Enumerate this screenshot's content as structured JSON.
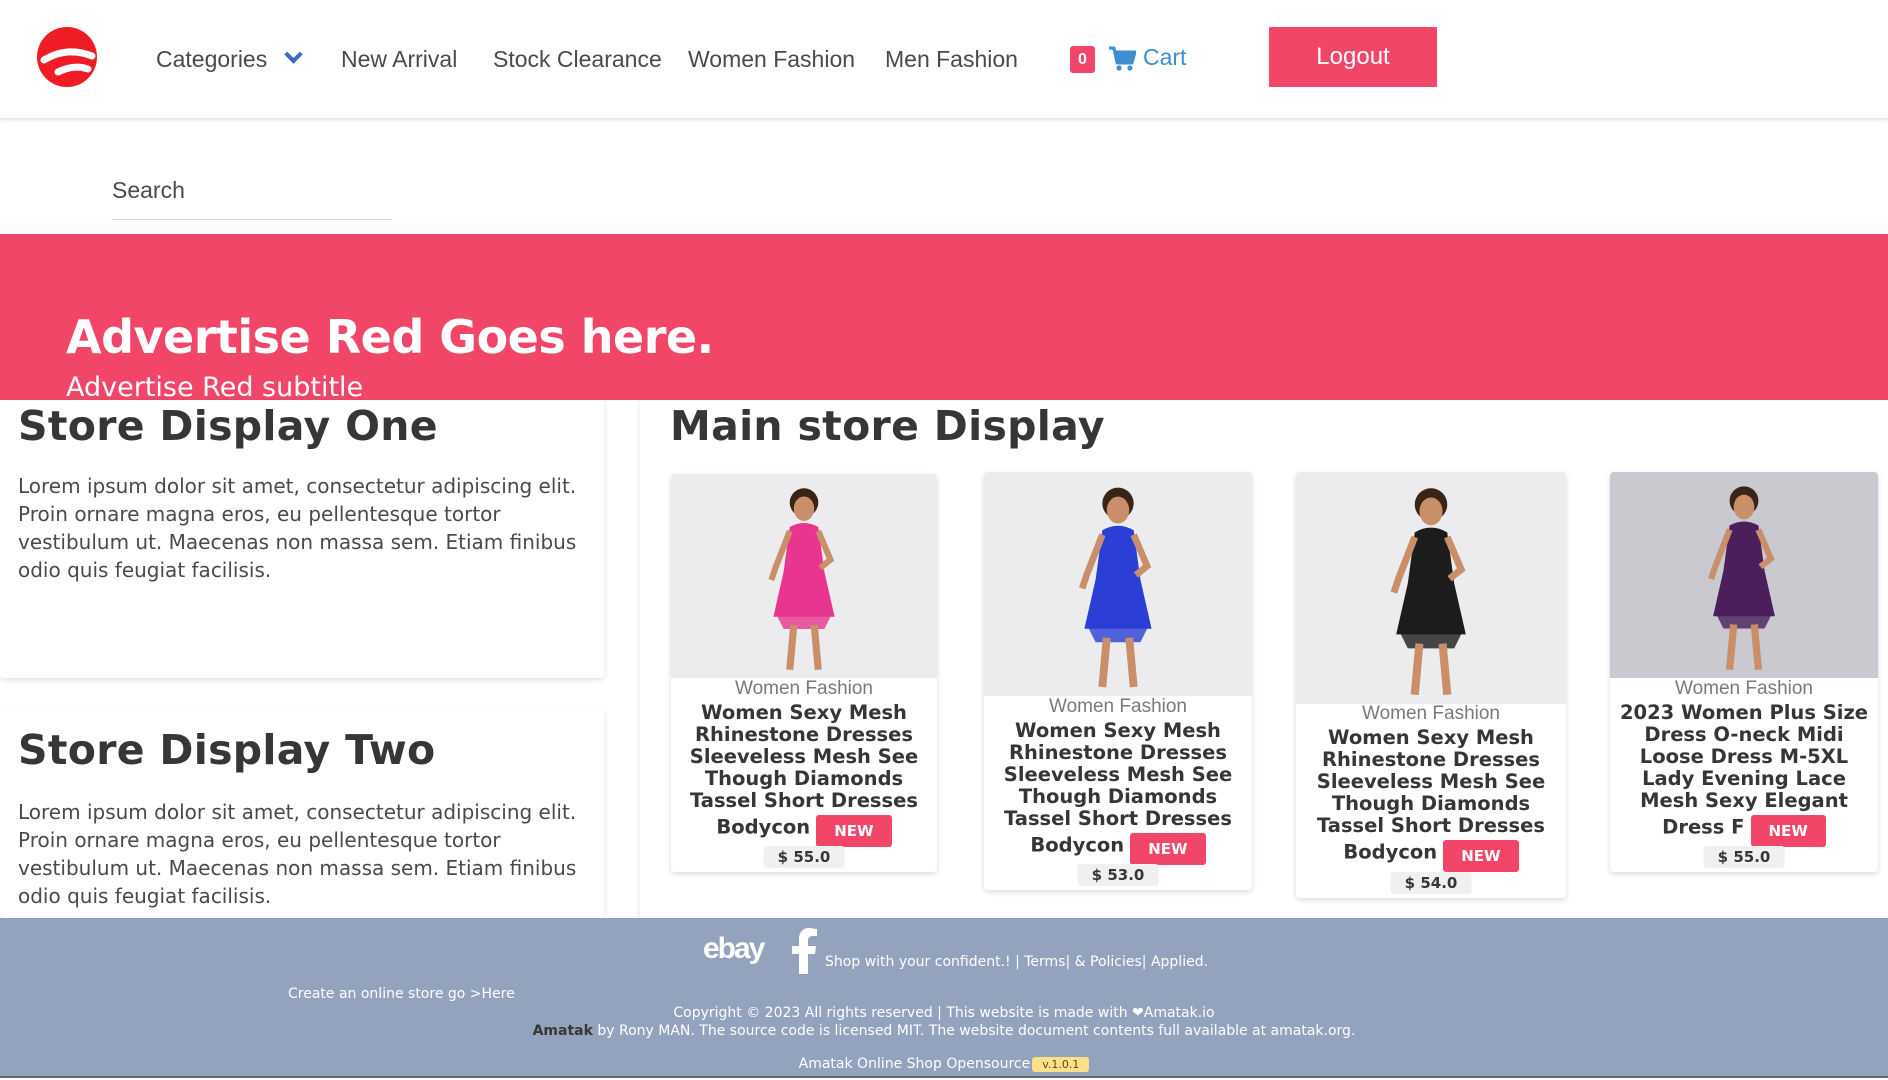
{
  "nav": {
    "categories": "Categories",
    "new_arrival": "New Arrival",
    "stock_clearance": "Stock Clearance",
    "women_fashion": "Women Fashion",
    "men_fashion": "Men Fashion",
    "cart_count": "0",
    "cart": "Cart",
    "logout": "Logout"
  },
  "search": {
    "placeholder": "Search"
  },
  "hero": {
    "title": "Advertise Red Goes here.",
    "subtitle": "Advertise Red subtitle"
  },
  "store_one": {
    "title": "Store Display One",
    "text": "Lorem ipsum dolor sit amet, consectetur adipiscing elit. Proin ornare magna eros, eu pellentesque tortor vestibulum ut. Maecenas non massa sem. Etiam finibus odio quis feugiat facilisis."
  },
  "store_two": {
    "title": "Store Display Two",
    "text": "Lorem ipsum dolor sit amet, consectetur adipiscing elit. Proin ornare magna eros, eu pellentesque tortor vestibulum ut. Maecenas non massa sem. Etiam finibus odio quis feugiat facilisis."
  },
  "main": {
    "title": "Main store Display",
    "products": [
      {
        "category": "Women Fashion",
        "name": "Women Sexy Mesh Rhinestone Dresses Sleeveless Mesh See Though Diamonds Tassel Short Dresses Bodycon",
        "badge": "NEW",
        "price": "$ 55.0",
        "dress_color": "#e8358f"
      },
      {
        "category": "Women Fashion",
        "name": "Women Sexy Mesh Rhinestone Dresses Sleeveless Mesh See Though Diamonds Tassel Short Dresses Bodycon",
        "badge": "NEW",
        "price": "$ 53.0",
        "dress_color": "#2b3fd6"
      },
      {
        "category": "Women Fashion",
        "name": "Women Sexy Mesh Rhinestone Dresses Sleeveless Mesh See Though Diamonds Tassel Short Dresses Bodycon",
        "badge": "NEW",
        "price": "$ 54.0",
        "dress_color": "#1c1c1c"
      },
      {
        "category": "Women Fashion",
        "name": "2023 Women Plus Size Dress O-neck Midi Loose Dress M-5XL Lady Evening Lace Mesh Sexy Elegant Dress F",
        "badge": "NEW",
        "price": "$ 55.0",
        "dress_color": "#4a1f5c"
      }
    ]
  },
  "footer": {
    "ebay": "ebay",
    "links": "Shop with your confident.! | Terms| & Policies| Applied.",
    "create": "Create an online store go >Here",
    "copyright": "Copyright © 2023 All rights reserved | This website is made with ❤Amatak.io",
    "license_brand": "Amatak",
    "license": " by Rony MAN. The source code is licensed MIT. The website document contents full available at amatak.org.",
    "opensource": "Amatak Online Shop Opensource",
    "version": "v.1.0.1"
  },
  "colors": {
    "accent": "#f14668",
    "link": "#3e8ed0",
    "footer_bg": "#93a3be"
  },
  "icons": [
    "logo-icon",
    "chevron-down-icon",
    "cart-icon",
    "facebook-icon"
  ]
}
